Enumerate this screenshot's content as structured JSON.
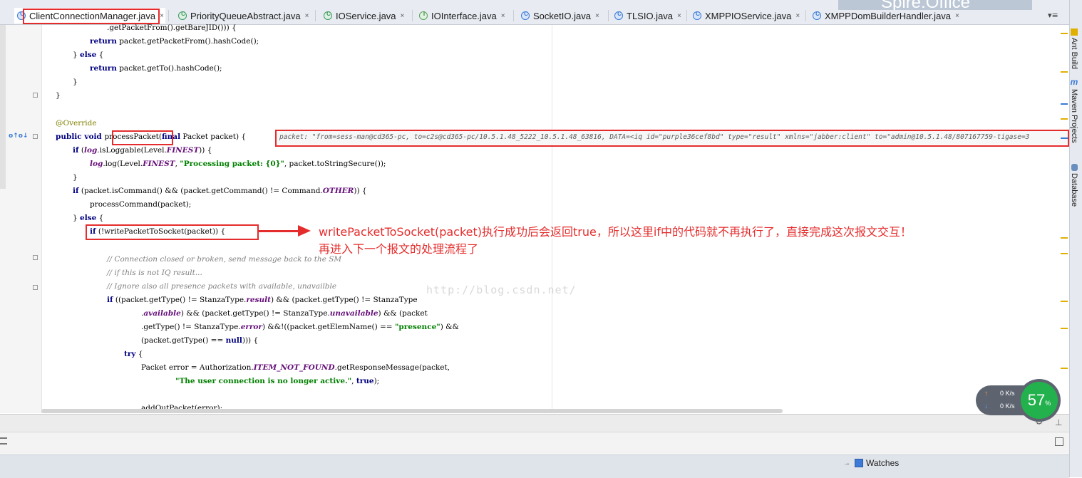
{
  "tabs": [
    {
      "label": "ClientConnectionManager.java",
      "icon": "class-icon",
      "letter": "C",
      "active": true
    },
    {
      "label": "PriorityQueueAbstract.java",
      "icon": "abstract-class-icon",
      "letter": "C",
      "active": false
    },
    {
      "label": "IOService.java",
      "icon": "abstract-class-icon",
      "letter": "C",
      "active": false
    },
    {
      "label": "IOInterface.java",
      "icon": "interface-icon",
      "letter": "I",
      "active": false
    },
    {
      "label": "SocketIO.java",
      "icon": "class-icon",
      "letter": "C",
      "active": false
    },
    {
      "label": "TLSIO.java",
      "icon": "class-icon",
      "letter": "C",
      "active": false
    },
    {
      "label": "XMPPIOService.java",
      "icon": "class-icon",
      "letter": "C",
      "active": false
    },
    {
      "label": "XMPPDomBuilderHandler.java",
      "icon": "class-icon",
      "letter": "C",
      "active": false
    }
  ],
  "tab_close": "×",
  "tab_menu": "▾≡",
  "watermark_overlay": "Spire.Office",
  "code_lines": {
    "l1": ".getPacketFrom().getBareJID())) {",
    "l2a": "return",
    "l2b": " packet.getPacketFrom().hashCode();",
    "l3a": "} ",
    "l3b": "else",
    "l3c": " {",
    "l4a": "return",
    "l4b": " packet.getTo().hashCode();",
    "l5": "}",
    "l6": "}",
    "l7": "@Override",
    "l8a": "public void ",
    "l8b": "processPacket",
    "l8c": "(",
    "l8d": "final",
    "l8e": " Packet packet) {",
    "l9a": "if",
    "l9b": " (",
    "l9c": "log",
    "l9d": ".isLoggable(Level.",
    "l9e": "FINEST",
    "l9f": ")) {",
    "l10a": "log",
    "l10b": ".log(Level.",
    "l10c": "FINEST",
    "l10d": ", ",
    "l10e": "\"Processing packet: {0}\"",
    "l10f": ", packet.toStringSecure());",
    "l11": "}",
    "l12a": "if",
    "l12b": " (packet.isCommand() && (packet.getCommand() != Command.",
    "l12c": "OTHER",
    "l12d": ")) {",
    "l13": "processCommand(packet);",
    "l14a": "} ",
    "l14b": "else",
    "l14c": " {",
    "l15a": "if",
    "l15b": " (!writePacketToSocket(packet)) {",
    "l16": "// Connection closed or broken, send message back to the SM",
    "l17": "// if this is not IQ result...",
    "l18": "// Ignore also all presence packets with available, unavailble",
    "l19a": "if",
    "l19b": " ((packet.getType() != StanzaType.",
    "l19c": "result",
    "l19d": ") && (packet.getType() != StanzaType",
    "l20a": ".",
    "l20b": "available",
    "l20c": ") && (packet.getType() != StanzaType.",
    "l20d": "unavailable",
    "l20e": ") && (packet",
    "l21a": ".getType() != StanzaType.",
    "l21b": "error",
    "l21c": ") &&!((packet.getElemName() == ",
    "l21d": "\"presence\"",
    "l21e": ") &&",
    "l22a": "(packet.getType() == ",
    "l22b": "null",
    "l22c": "))) {",
    "l23a": "try",
    "l23b": " {",
    "l24a": "Packet error = Authorization.",
    "l24b": "ITEM_NOT_FOUND",
    "l24c": ".getResponseMessage(packet,",
    "l25a": "\"The user connection is no longer active.\"",
    "l25b": ", ",
    "l25c": "true",
    "l25d": ");",
    "l26": "addOutPacket(error);"
  },
  "debug_hint": "packet: \"from=sess-man@cd365-pc, to=c2s@cd365-pc/10.5.1.48_5222_10.5.1.48_63816, DATA=<iq id=\"purple36cef8bd\" type=\"result\" xmlns=\"jabber:client\" to=\"admin@10.5.1.48/807167759-tigase=3",
  "annotation": {
    "line1": "writePacketToSocket(packet)执行成功后会返回true，所以这里if中的代码就不再执行了，直接完成这次报文交互！",
    "line2": "再进入下一个报文的处理流程了"
  },
  "blog_watermark": "http://blog.csdn.net/",
  "right_tools": [
    "Ant Build",
    "Maven Projects",
    "Database"
  ],
  "watches_label": "Watches",
  "net_widget": {
    "up": "0",
    "down": "0",
    "unit": "K/s",
    "percent": "57",
    "percent_sign": "%"
  },
  "colors": {
    "annotation_red": "#e52c2c",
    "keyword": "#000080",
    "string": "#008000",
    "comment": "#808080",
    "static_field": "#660e7a",
    "gauge_green": "#22b14c"
  }
}
